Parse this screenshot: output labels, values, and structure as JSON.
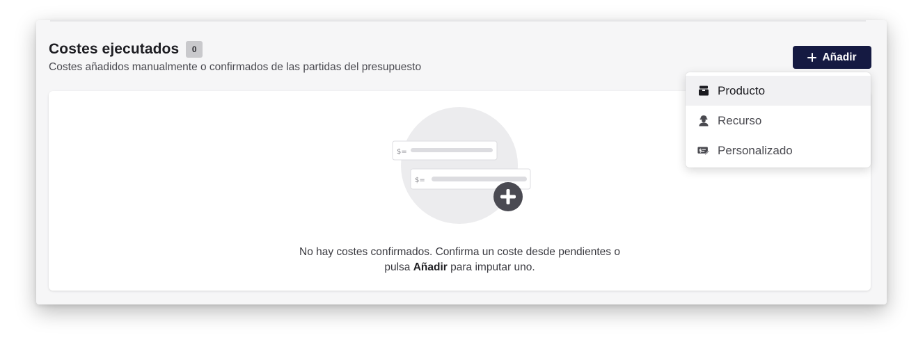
{
  "section": {
    "title": "Costes ejecutados",
    "count": "0",
    "subtitle": "Costes añadidos manualmente o confirmados de las partidas del presupuesto"
  },
  "add_button": {
    "label": "Añadir",
    "icon": "plus-icon",
    "color": "#151a42"
  },
  "empty_state": {
    "line1": "No hay costes confirmados. Confirma un coste desde pendientes o",
    "line2_prefix": "pulsa ",
    "line2_bold": "Añadir",
    "line2_suffix": " para imputar uno.",
    "illustration_row_label_1": "$=",
    "illustration_row_label_2": "$="
  },
  "dropdown": {
    "items": [
      {
        "label": "Producto",
        "icon": "box-icon",
        "active": true
      },
      {
        "label": "Recurso",
        "icon": "worker-icon",
        "active": false
      },
      {
        "label": "Personalizado",
        "icon": "custom-cost-icon",
        "active": false
      }
    ]
  }
}
